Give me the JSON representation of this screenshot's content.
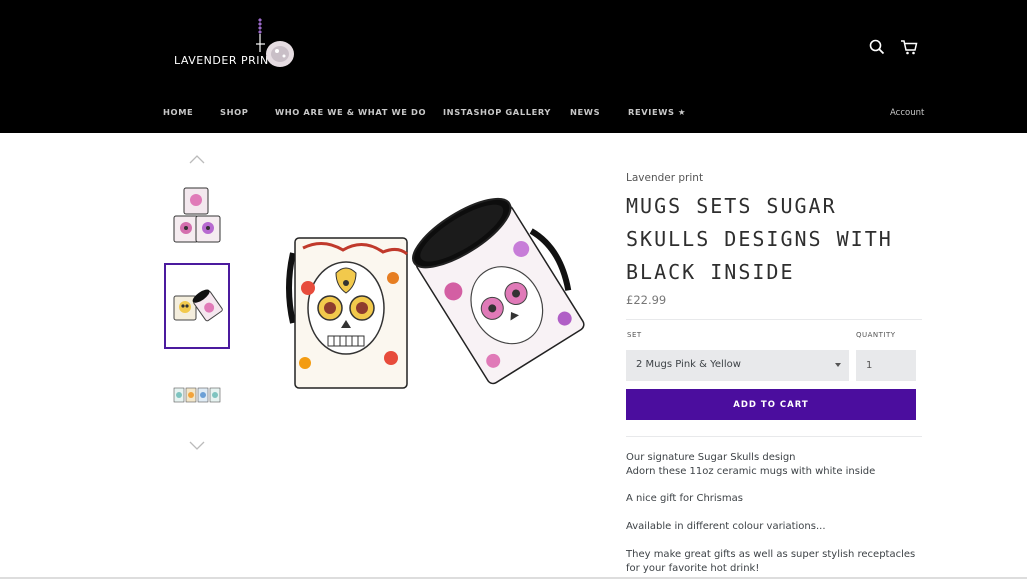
{
  "header": {
    "logo_text": "LAVENDER PRINT",
    "search_icon": "search-icon",
    "cart_icon": "cart-icon",
    "nav": [
      "HOME",
      "SHOP",
      "WHO ARE WE & WHAT WE DO",
      "INSTASHOP GALLERY",
      "NEWS",
      "REVIEWS ★"
    ],
    "account_label": "Account"
  },
  "gallery": {
    "up_icon": "chevron-up-icon",
    "down_icon": "chevron-down-icon",
    "active_thumb": 2
  },
  "product": {
    "vendor": "Lavender print",
    "title": "MUGS SETS SUGAR SKULLS DESIGNS WITH BLACK INSIDE",
    "price": "£22.99",
    "set_label": "SET",
    "set_value": "2 Mugs Pink & Yellow",
    "quantity_label": "QUANTITY",
    "quantity_value": "1",
    "add_to_cart": "ADD TO CART",
    "description": [
      "Our signature Sugar Skulls design",
      "Adorn these 11oz ceramic mugs with white inside",
      "A nice gift for Chrismas",
      "Available in different colour variations...",
      "They make great gifts as well as super stylish receptacles",
      "for your favorite hot drink!"
    ]
  },
  "colors": {
    "header_bg": "#000000",
    "accent": "#4b0d9e",
    "nav_text": "#c8c8c8"
  }
}
